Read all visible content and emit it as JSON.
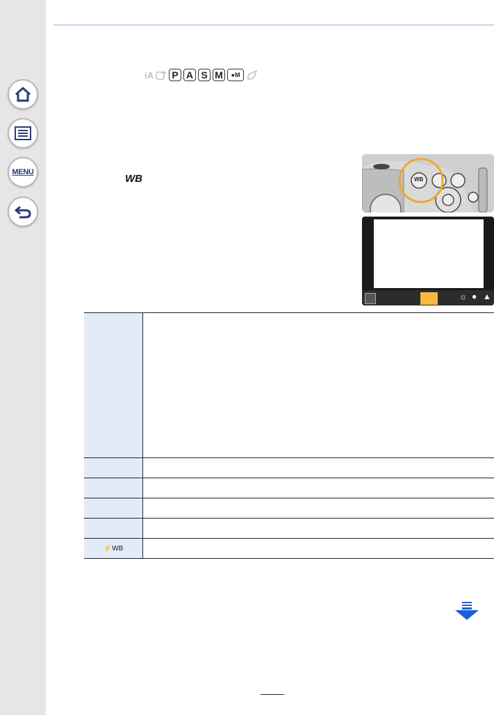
{
  "sidebar": {
    "items": [
      {
        "name": "home-icon"
      },
      {
        "name": "contents-icon"
      },
      {
        "label": "MENU"
      },
      {
        "name": "back-icon"
      }
    ]
  },
  "mode_icons": {
    "ghost_ia": "iA",
    "p": "P",
    "a": "A",
    "s": "S",
    "m": "M",
    "movie_m": "M"
  },
  "instruction": {
    "button_label": "WB"
  },
  "camera_top": {
    "button_label": "WB"
  },
  "table": {
    "rows": [
      {
        "key": "",
        "value": ""
      },
      {
        "key": "",
        "value": ""
      },
      {
        "key": "",
        "value": ""
      },
      {
        "key": "",
        "value": ""
      },
      {
        "key": "",
        "value": ""
      },
      {
        "key": "⚡WB",
        "value": ""
      }
    ]
  },
  "colors": {
    "sidebar_bg": "#e6e6e6",
    "header_rule": "#c8d4ec",
    "table_key_bg": "#e3eaf8",
    "highlight": "#f5b942",
    "arrow": "#1e5fd6"
  }
}
